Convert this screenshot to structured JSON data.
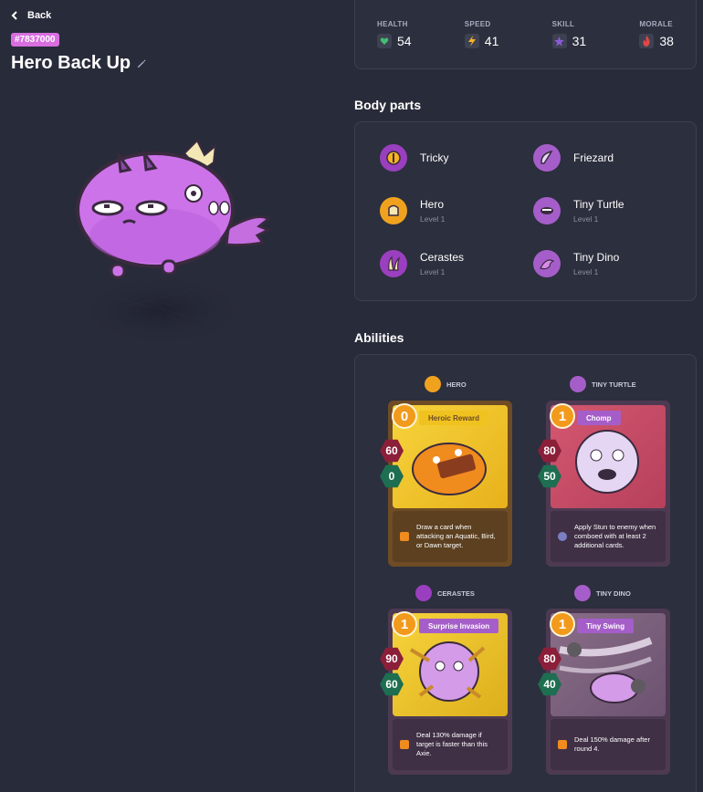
{
  "header": {
    "back_label": "Back",
    "axie_id": "#7837000",
    "title": "Hero Back Up"
  },
  "stats": [
    {
      "label": "HEALTH",
      "value": "54",
      "icon": "heart-icon",
      "color": "#3fbf6f"
    },
    {
      "label": "SPEED",
      "value": "41",
      "icon": "lightning-icon",
      "color": "#f5b321"
    },
    {
      "label": "SKILL",
      "value": "31",
      "icon": "star-icon",
      "color": "#8a5bd8"
    },
    {
      "label": "MORALE",
      "value": "38",
      "icon": "flame-icon",
      "color": "#e04848"
    }
  ],
  "body_parts": {
    "title": "Body parts",
    "items": [
      {
        "name": "Tricky",
        "level": "",
        "icon": "eye-part-icon"
      },
      {
        "name": "Friezard",
        "level": "",
        "icon": "ears-part-icon"
      },
      {
        "name": "Hero",
        "level": "Level 1",
        "icon": "back-part-icon"
      },
      {
        "name": "Tiny Turtle",
        "level": "Level 1",
        "icon": "mouth-part-icon"
      },
      {
        "name": "Cerastes",
        "level": "Level 1",
        "icon": "horn-part-icon"
      },
      {
        "name": "Tiny Dino",
        "level": "Level 1",
        "icon": "tail-part-icon"
      }
    ]
  },
  "abilities": {
    "title": "Abilities",
    "cards": [
      {
        "part": "HERO",
        "name": "Heroic Reward",
        "energy": "0",
        "attack": "60",
        "shield": "0",
        "description": "Draw a card when attacking an Aquatic, Bird, or Dawn target.",
        "theme": "#f0c21f"
      },
      {
        "part": "TINY TURTLE",
        "name": "Chomp",
        "energy": "1",
        "attack": "80",
        "shield": "50",
        "description": "Apply Stun to enemy when comboed with at least 2 additional cards.",
        "theme": "#c64d6a"
      },
      {
        "part": "CERASTES",
        "name": "Surprise Invasion",
        "energy": "1",
        "attack": "90",
        "shield": "60",
        "description": "Deal 130% damage if target is faster than this Axie.",
        "theme": "#f0c21f"
      },
      {
        "part": "TINY DINO",
        "name": "Tiny Swing",
        "energy": "1",
        "attack": "80",
        "shield": "40",
        "description": "Deal 150% damage after round 4.",
        "theme": "#7d5c8c"
      }
    ]
  },
  "colors": {
    "background": "#282b39",
    "panel": "#2c2f3d",
    "accent_pink": "#d86ee0",
    "card_purple": "#a55ec9"
  }
}
